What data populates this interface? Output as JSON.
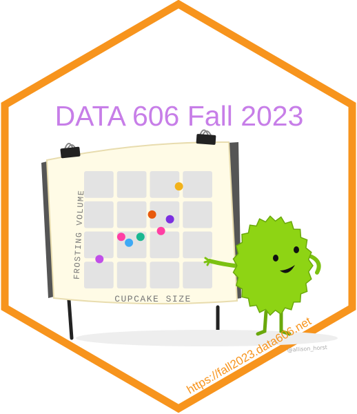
{
  "sticker": {
    "title": "DATA 606 Fall 2023",
    "url": "https://fall2023.data606.net",
    "artist_signature": "@allison_horst"
  },
  "colors": {
    "hex_border": "#f7941d",
    "title": "#c77ee8",
    "url": "#f7941d",
    "monster_body": "#8ed414",
    "monster_shadow": "#6aa80c",
    "board_frame": "#fffbe6",
    "grid_cell": "#e3e3e3"
  },
  "chart_data": {
    "type": "scatter",
    "xlabel": "CUPCAKE SIZE",
    "ylabel": "FROSTING VOLUME",
    "points": [
      {
        "x": 0.74,
        "y": 0.87,
        "color": "#f2b21b"
      },
      {
        "x": 0.53,
        "y": 0.63,
        "color": "#e8590c"
      },
      {
        "x": 0.67,
        "y": 0.59,
        "color": "#7b2fe0"
      },
      {
        "x": 0.6,
        "y": 0.49,
        "color": "#ff3fa4"
      },
      {
        "x": 0.29,
        "y": 0.44,
        "color": "#ff3fa4"
      },
      {
        "x": 0.44,
        "y": 0.44,
        "color": "#1bb891"
      },
      {
        "x": 0.35,
        "y": 0.39,
        "color": "#3fa9f5"
      },
      {
        "x": 0.12,
        "y": 0.25,
        "color": "#c04fe8"
      }
    ]
  }
}
